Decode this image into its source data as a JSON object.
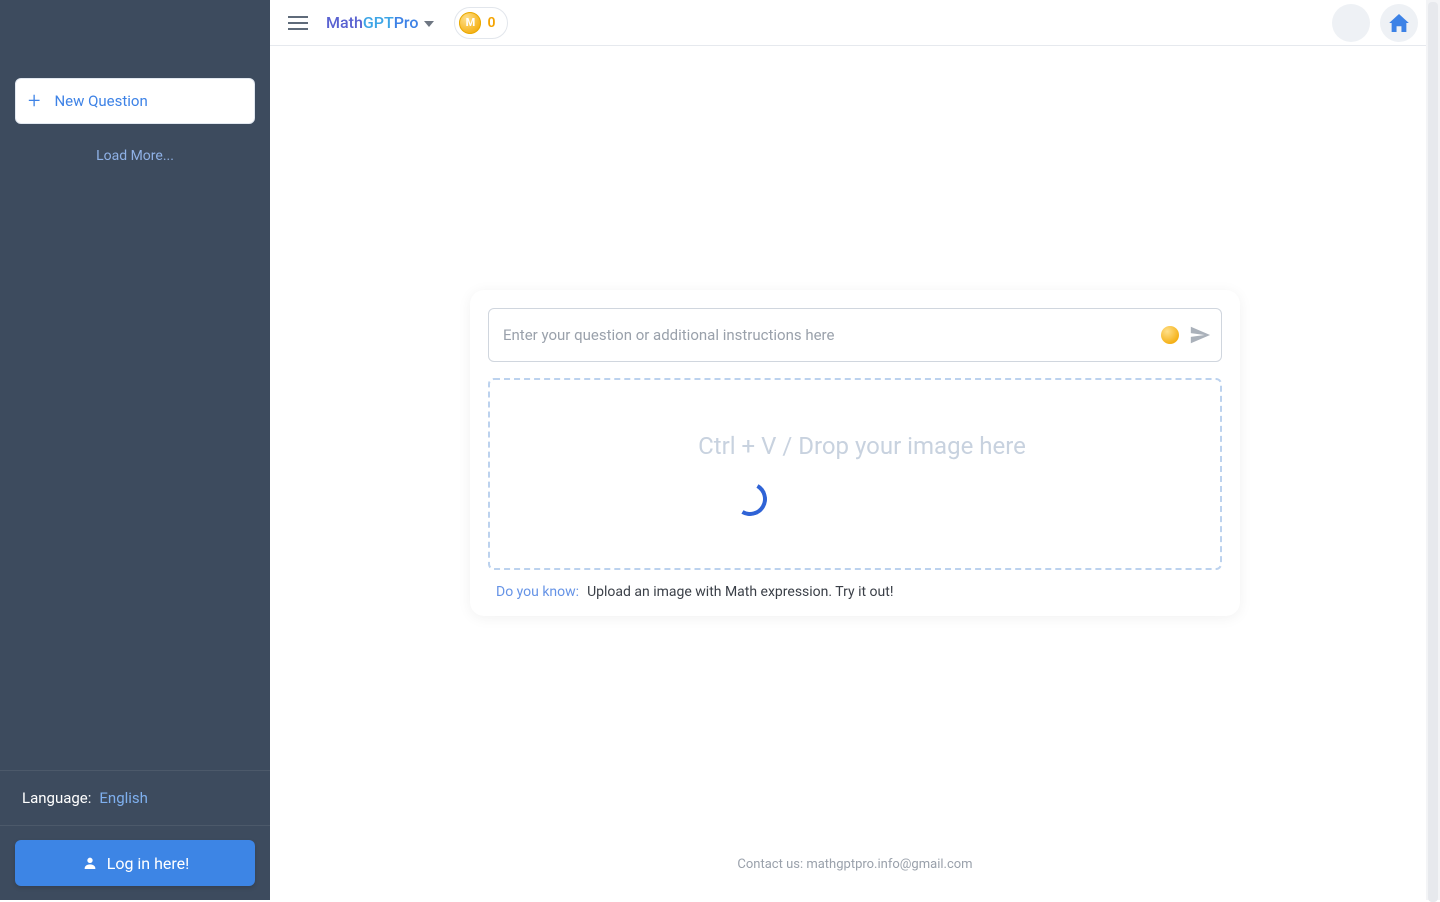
{
  "sidebar": {
    "new_question_label": "New Question",
    "load_more_label": "Load More...",
    "language_label": "Language:",
    "language_value": "English",
    "login_label": "Log in here!"
  },
  "topbar": {
    "brand_part1": "Math",
    "brand_part2": "GPT",
    "brand_part3": "Pro",
    "coin_letter": "M",
    "coin_count": "0"
  },
  "composer": {
    "placeholder": "Enter your question or additional instructions here",
    "dropzone_text": "Ctrl + V / Drop your image here",
    "tip_label": "Do you know:",
    "tip_text": "Upload an image with Math expression. Try it out!"
  },
  "footer": {
    "contact_text": "Contact us: mathgptpro.info@gmail.com"
  },
  "icons": {
    "plus": "+",
    "home": "home",
    "send": "send",
    "menu": "menu",
    "chevron_down": "chevron-down"
  }
}
